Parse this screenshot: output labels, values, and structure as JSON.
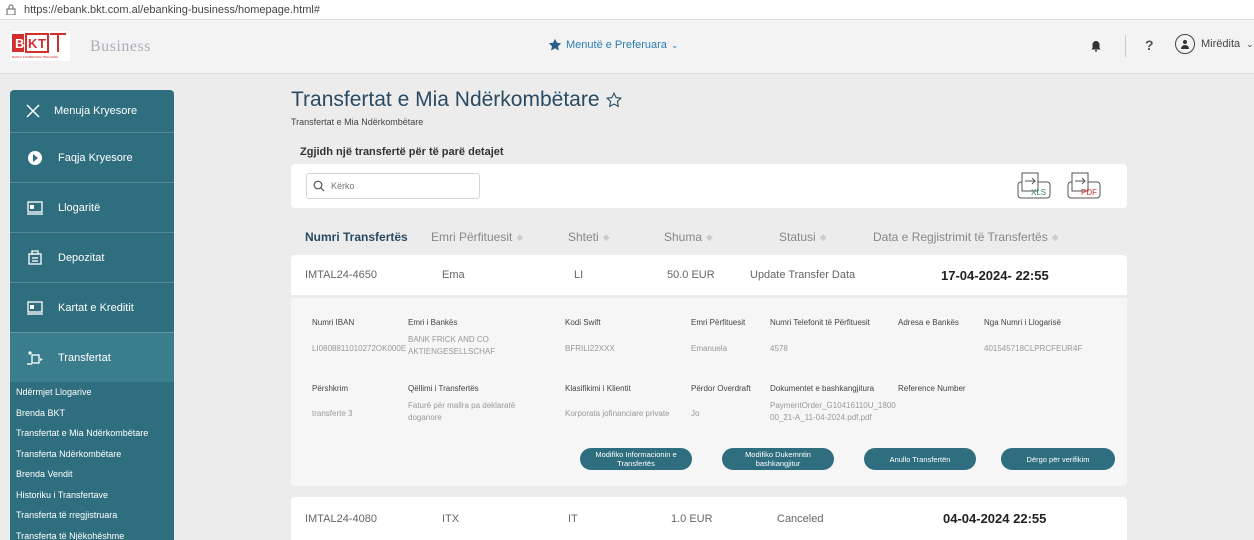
{
  "browser": {
    "url": "https://ebank.bkt.com.al/ebanking-business/homepage.html#"
  },
  "header": {
    "logo_text": "BKT",
    "logo_tagline": "BANKA KOMBETARE TREGTARE",
    "brand_sub": "Business",
    "favorites_label": "Menutë e Preferuara",
    "help_label": "?",
    "user_greeting": "Mirëdita"
  },
  "sidebar": {
    "menu_label": "Menuja Kryesore",
    "items": [
      {
        "label": "Faqja Kryesore",
        "icon": "home-icon"
      },
      {
        "label": "Llogaritë",
        "icon": "accounts-icon"
      },
      {
        "label": "Depozitat",
        "icon": "deposit-icon"
      },
      {
        "label": "Kartat e Kreditit",
        "icon": "card-icon"
      },
      {
        "label": "Transfertat",
        "icon": "transfer-icon"
      }
    ],
    "sub_items": [
      "Ndërmjet Llogarive",
      "Brenda BKT",
      "Transfertat e Mia Ndërkombëtare",
      "Transferta Ndërkombëtare",
      "Brenda Vendit",
      "Historiku i Transfertave",
      "Transferta të rregjistruara",
      "Transferta të Njëkohëshme"
    ]
  },
  "main": {
    "title": "Transfertat e Mia Ndërkombëtare",
    "breadcrumb": "Transfertat e Mia Ndërkombëtare",
    "select_prompt": "Zgjidh një transfertë për të parë detajet",
    "search_placeholder": "Kërko",
    "export": {
      "xls": "XLS",
      "pdf": "PDF"
    },
    "columns": [
      "Numri Transfertës",
      "Emri Përfituesit",
      "Shteti",
      "Shuma",
      "Statusi",
      "Data e Regjistrimit të Transfertës"
    ],
    "rows": [
      {
        "number": "IMTAL24-4650",
        "beneficiary": "Ema",
        "country": "LI",
        "amount": "50.0 EUR",
        "status": "Update Transfer Data",
        "date": "17-04-2024- 22:55"
      },
      {
        "number": "IMTAL24-4080",
        "beneficiary": "ITX",
        "country": "IT",
        "amount": "1.0 EUR",
        "status": "Canceled",
        "date": "04-04-2024 22:55"
      }
    ],
    "detail": {
      "labels": {
        "iban": "Numri IBAN",
        "bank_name": "Emri i Bankës",
        "swift": "Kodi Swift",
        "beneficiary": "Emri Përfituesit",
        "phone": "Numri Telefonit të Përfituesit",
        "bank_address": "Adresa e Bankës",
        "from_account": "Nga Numri i Llogarisë",
        "description": "Përshkrim",
        "purpose": "Qëllimi i Transfertës",
        "client_class": "Klasifikimi i Klientit",
        "overdraft": "Përdor Overdraft",
        "documents": "Dokumentet e bashkangjitura",
        "reference": "Reference Number"
      },
      "values": {
        "iban": "LI0808811010272OK000E",
        "bank_name": "BANK FRICK AND CO AKTIENGESELLSCHAF",
        "swift": "BFRILI22XXX",
        "beneficiary": "Emanuela",
        "phone": "4578",
        "bank_address": "",
        "from_account": "401545718CLPRCFEUR4F",
        "description": "transferte 3",
        "purpose": "Faturë për mallra pa deklaratë doganore",
        "client_class": "Korporata jofinanciare private",
        "overdraft": "Jo",
        "documents": "PaymentOrder_G10416110U_180000_21-A_11-04-2024.pdf.pdf",
        "reference": ""
      },
      "buttons": {
        "modify_info": "Modifiko Informacionin e Transfertës",
        "modify_doc": "Modifiko Dukemntin bashkangjitur",
        "cancel": "Anullo Transfertën",
        "verify": "Dërgo për verifikim"
      }
    }
  },
  "colors": {
    "sidebar": "#2e6e7e",
    "accent": "#2a7fb0",
    "title": "#2a4a62"
  }
}
